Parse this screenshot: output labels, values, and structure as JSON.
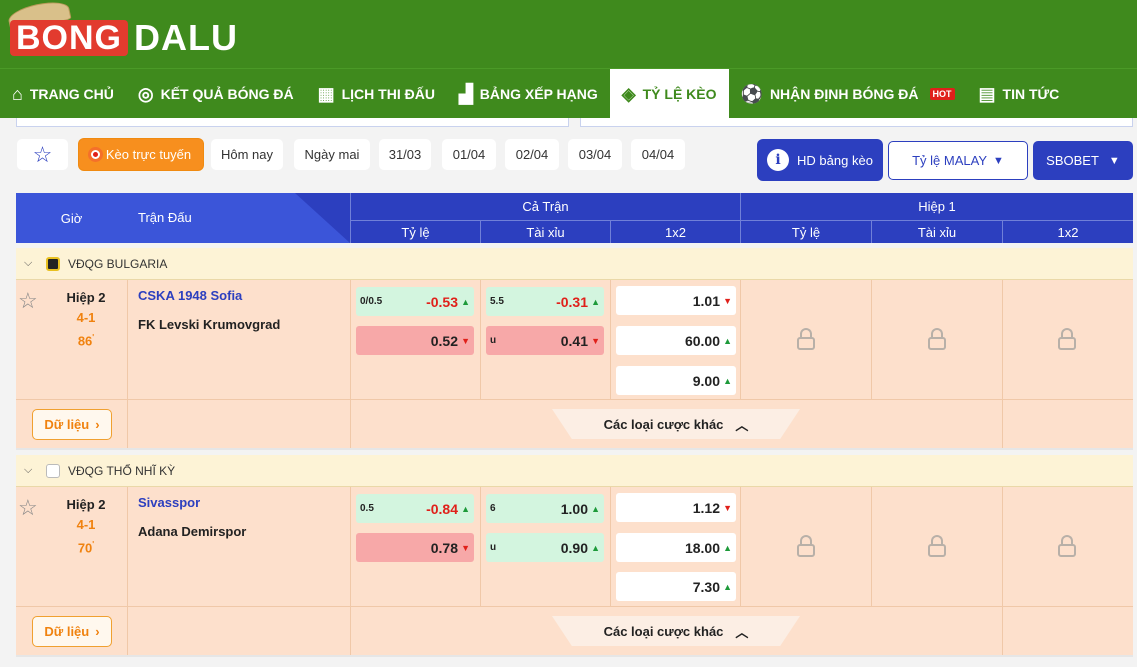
{
  "brand": {
    "part1": "BONG",
    "part2": "DALU"
  },
  "nav": [
    {
      "label": "TRANG CHỦ",
      "icon": "home-icon",
      "glyph": "⌂"
    },
    {
      "label": "KẾT QUẢ BÓNG ĐÁ",
      "icon": "volleyball-icon",
      "glyph": "◎"
    },
    {
      "label": "LỊCH THI ĐẤU",
      "icon": "calendar-icon",
      "glyph": "▦"
    },
    {
      "label": "BẢNG XẾP HẠNG",
      "icon": "podium-icon",
      "glyph": "▟"
    },
    {
      "label": "TỶ LỆ KÈO",
      "icon": "dice-icon",
      "glyph": "◈",
      "active": true
    },
    {
      "label": "NHẬN ĐỊNH BÓNG ĐÁ",
      "icon": "soccer-ball-icon",
      "glyph": "⚽",
      "badge": "HOT"
    },
    {
      "label": "TIN TỨC",
      "icon": "newspaper-icon",
      "glyph": "▤"
    }
  ],
  "filters": {
    "live": "Kèo trực tuyến",
    "dates": [
      "Hôm nay",
      "Ngày mai",
      "31/03",
      "01/04",
      "02/04",
      "03/04",
      "04/04"
    ],
    "hd_guide": "HD bảng kèo",
    "odds_format": "Tỷ lệ MALAY",
    "bookmaker": "SBOBET"
  },
  "table_header": {
    "time": "Giờ",
    "match": "Trận Đấu",
    "full_match": "Cả Trận",
    "half1": "Hiệp 1",
    "handicap": "Tỷ lệ",
    "over_under": "Tài xỉu",
    "x12": "1x2"
  },
  "leagues": [
    {
      "name": "VĐQG BULGARIA",
      "match": {
        "period": "Hiệp 2",
        "score": "4-1",
        "minute": "86",
        "minute_mark": "'",
        "home": "CSKA 1948 Sofia",
        "away": "FK Levski Krumovgrad",
        "hdp_line": "0/0.5",
        "hdp_home": "-0.53",
        "hdp_away": "0.52",
        "ou_line": "5.5",
        "ou_over": "-0.31",
        "ou_under_label": "u",
        "ou_under": "0.41",
        "x1": "1.01",
        "x2": "60.00",
        "xx": "9.00",
        "data_btn": "Dữ liệu",
        "more": "Các loại cược khác"
      }
    },
    {
      "name": "VĐQG THỔ NHĨ KỲ",
      "match": {
        "period": "Hiệp 2",
        "score": "4-1",
        "minute": "70",
        "minute_mark": "'",
        "home": "Sivasspor",
        "away": "Adana Demirspor",
        "hdp_line": "0.5",
        "hdp_home": "-0.84",
        "hdp_away": "0.78",
        "ou_line": "6",
        "ou_over": "1.00",
        "ou_under_label": "u",
        "ou_under": "0.90",
        "x1": "1.12",
        "x2": "18.00",
        "xx": "7.30",
        "data_btn": "Dữ liệu",
        "more": "Các loại cược khác"
      }
    }
  ],
  "colors": {
    "brand_green": "#3f8a1d",
    "primary_blue": "#2c3fbf",
    "orange": "#f78f1e",
    "row_bg": "#fde0cc"
  }
}
